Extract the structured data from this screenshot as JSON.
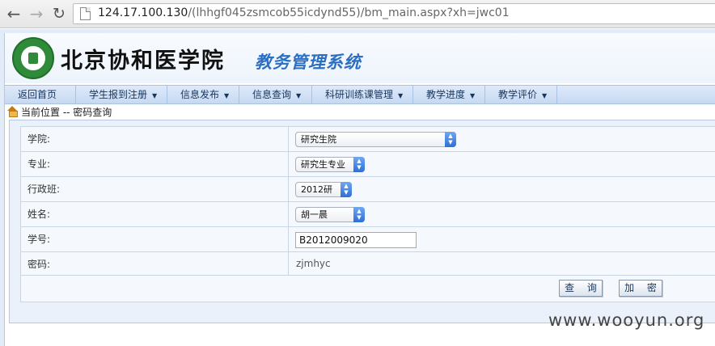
{
  "browser": {
    "url_host": "124.17.100.130",
    "url_path": "/(lhhgf045zsmcob55icdynd55)/bm_main.aspx?xh=jwc01"
  },
  "header": {
    "school_name": "北京协和医学院",
    "system_name": "教务管理系统"
  },
  "menu": {
    "items": [
      {
        "label": "返回首页",
        "has_dropdown": false
      },
      {
        "label": "学生报到注册",
        "has_dropdown": true
      },
      {
        "label": "信息发布",
        "has_dropdown": true
      },
      {
        "label": "信息查询",
        "has_dropdown": true
      },
      {
        "label": "科研训练课管理",
        "has_dropdown": true
      },
      {
        "label": "教学进度",
        "has_dropdown": true
      },
      {
        "label": "教学评价",
        "has_dropdown": true
      }
    ]
  },
  "breadcrumb": {
    "text": "当前位置 -- 密码查询"
  },
  "form": {
    "college_label": "学院:",
    "college_value": "研究生院",
    "major_label": "专业:",
    "major_value": "研究生专业",
    "class_label": "行政班:",
    "class_value": "2012研",
    "name_label": "姓名:",
    "name_value": "胡一晨",
    "student_id_label": "学号:",
    "student_id_value": "B2012009020",
    "password_label": "密码:",
    "password_value": "zjmhyc",
    "query_button": "查 询",
    "encrypt_button": "加 密"
  },
  "watermark": "www.wooyun.org",
  "colors": {
    "accent": "#2b6fc2",
    "menu_bg": "#c6d9f2",
    "panel_bg": "#ebf1fa"
  }
}
